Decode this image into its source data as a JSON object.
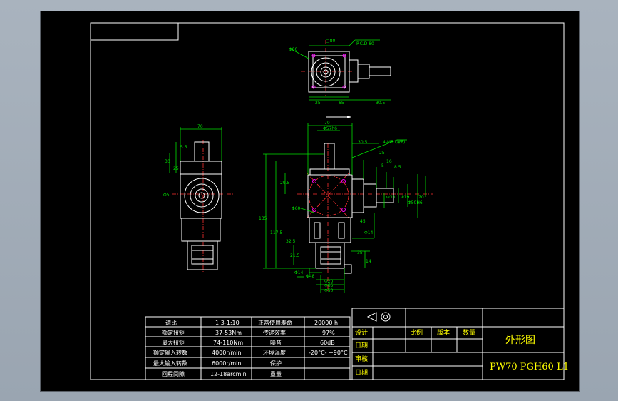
{
  "spec_table": {
    "rows": [
      {
        "label": "速比",
        "value": "1:3-1:10",
        "label2": "正常使用寿命",
        "value2": "20000 h"
      },
      {
        "label": "额定扭矩",
        "value": "37-53Nm",
        "label2": "传递效率",
        "value2": "97%"
      },
      {
        "label": "最大扭矩",
        "value": "74-110Nm",
        "label2": "噪音",
        "value2": "60dB"
      },
      {
        "label": "额定输入转数",
        "value": "4000r/min",
        "label2": "环境温度",
        "value2": "-20°C- +90°C"
      },
      {
        "label": "最大输入转数",
        "value": "6000r/min",
        "label2": "保护",
        "value2": ""
      },
      {
        "label": "回程间隙",
        "value": "12-18arcmin",
        "label2": "重量",
        "value2": ""
      }
    ]
  },
  "title_block": {
    "headers": [
      "设计",
      "比例",
      "版本",
      "数量"
    ],
    "row_labels": [
      "日期",
      "审核",
      "日期"
    ],
    "drawing_title": "外形图",
    "model": "PW70 PGH60-L1"
  },
  "dimensions": {
    "top_view": [
      "□80",
      "P.C.D 80",
      "Φ80",
      "25",
      "65",
      "30.5"
    ],
    "front_view": [
      "70",
      "Φ57h6",
      "30.5",
      "4-M5 (深8)",
      "25",
      "16",
      "8.5",
      "5",
      "29.5",
      "Φ60",
      "Φ30",
      "Φ19",
      "135",
      "117.5",
      "32.5",
      "21.5",
      "Φ14",
      "Φ48",
      "Φ20",
      "Φ65",
      "Φ50",
      "Φ14",
      "Φ50H6",
      "70",
      "45",
      "35",
      "14"
    ],
    "side_view": [
      "70",
      "5.5",
      "30",
      "25",
      "Φ5"
    ]
  },
  "colors": {
    "background": "#000000",
    "geometry": "#ffffff",
    "dimension": "#00e000",
    "center_line": "#ff3030",
    "hole_marker": "#ff00ff",
    "title_text": "#ffff00"
  }
}
